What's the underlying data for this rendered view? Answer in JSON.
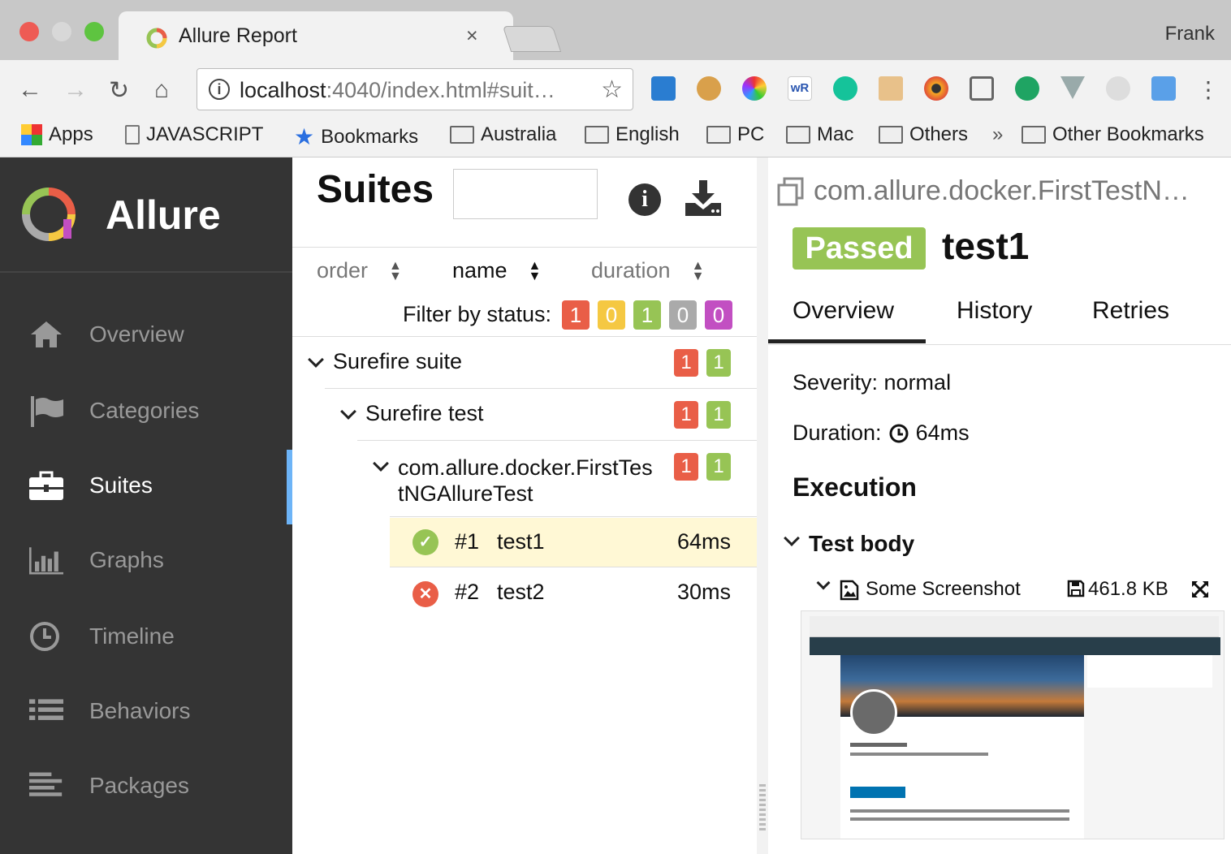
{
  "browser": {
    "tab_title": "Allure Report",
    "tab_close": "×",
    "user": "Frank",
    "url_host": "localhost",
    "url_rest": ":4040/index.html#suit…",
    "bookmarks": [
      "Apps",
      "JAVASCRIPT",
      "Bookmarks",
      "Australia",
      "English",
      "PC",
      "Mac",
      "Others",
      "»",
      "Other Bookmarks"
    ],
    "extension_icons": [
      "s-icon",
      "cookie-icon",
      "color-wheel-icon",
      "wr-icon",
      "grammarly-icon",
      "ruler-icon",
      "eye-icon",
      "cast-icon",
      "chat-bubble-icon",
      "v-icon",
      "circle-icon",
      "eyedropper-icon",
      "menu-dots-icon"
    ]
  },
  "sidebar": {
    "brand": "Allure",
    "items": [
      {
        "label": "Overview",
        "icon": "home-icon"
      },
      {
        "label": "Categories",
        "icon": "flag-icon"
      },
      {
        "label": "Suites",
        "icon": "briefcase-icon",
        "active": true
      },
      {
        "label": "Graphs",
        "icon": "bar-chart-icon"
      },
      {
        "label": "Timeline",
        "icon": "clock-icon"
      },
      {
        "label": "Behaviors",
        "icon": "list-icon"
      },
      {
        "label": "Packages",
        "icon": "align-left-icon"
      }
    ]
  },
  "suites": {
    "title": "Suites",
    "sort": {
      "order": "order",
      "name": "name",
      "duration": "duration"
    },
    "filter_label": "Filter by status:",
    "filter_counts": [
      "1",
      "0",
      "1",
      "0",
      "0"
    ],
    "tree": {
      "suite": {
        "name": "Surefire suite",
        "failed": "1",
        "passed": "1"
      },
      "test": {
        "name": "Surefire test",
        "failed": "1",
        "passed": "1"
      },
      "class": {
        "name_line1": "com.allure.docker.FirstTes",
        "name_line2": "tNGAllureTest",
        "failed": "1",
        "passed": "1"
      },
      "cases": [
        {
          "num": "#1",
          "name": "test1",
          "duration": "64ms",
          "status": "passed"
        },
        {
          "num": "#2",
          "name": "test2",
          "duration": "30ms",
          "status": "failed"
        }
      ]
    }
  },
  "detail": {
    "breadcrumb": "com.allure.docker.FirstTestN…",
    "status": "Passed",
    "name": "test1",
    "tabs": [
      "Overview",
      "History",
      "Retries"
    ],
    "severity": "Severity: normal",
    "duration_label": "Duration:",
    "duration": "64ms",
    "execution": "Execution",
    "test_body": "Test body",
    "attachment": "Some Screenshot",
    "attachment_size": "461.8 KB"
  },
  "colors": {
    "failed": "#e95e47",
    "broken": "#f5c842",
    "passed": "#97c455",
    "skipped": "#aaaaaa",
    "unknown": "#c24fc2",
    "sidebar": "#343434",
    "active_indicator": "#6db4f7"
  }
}
